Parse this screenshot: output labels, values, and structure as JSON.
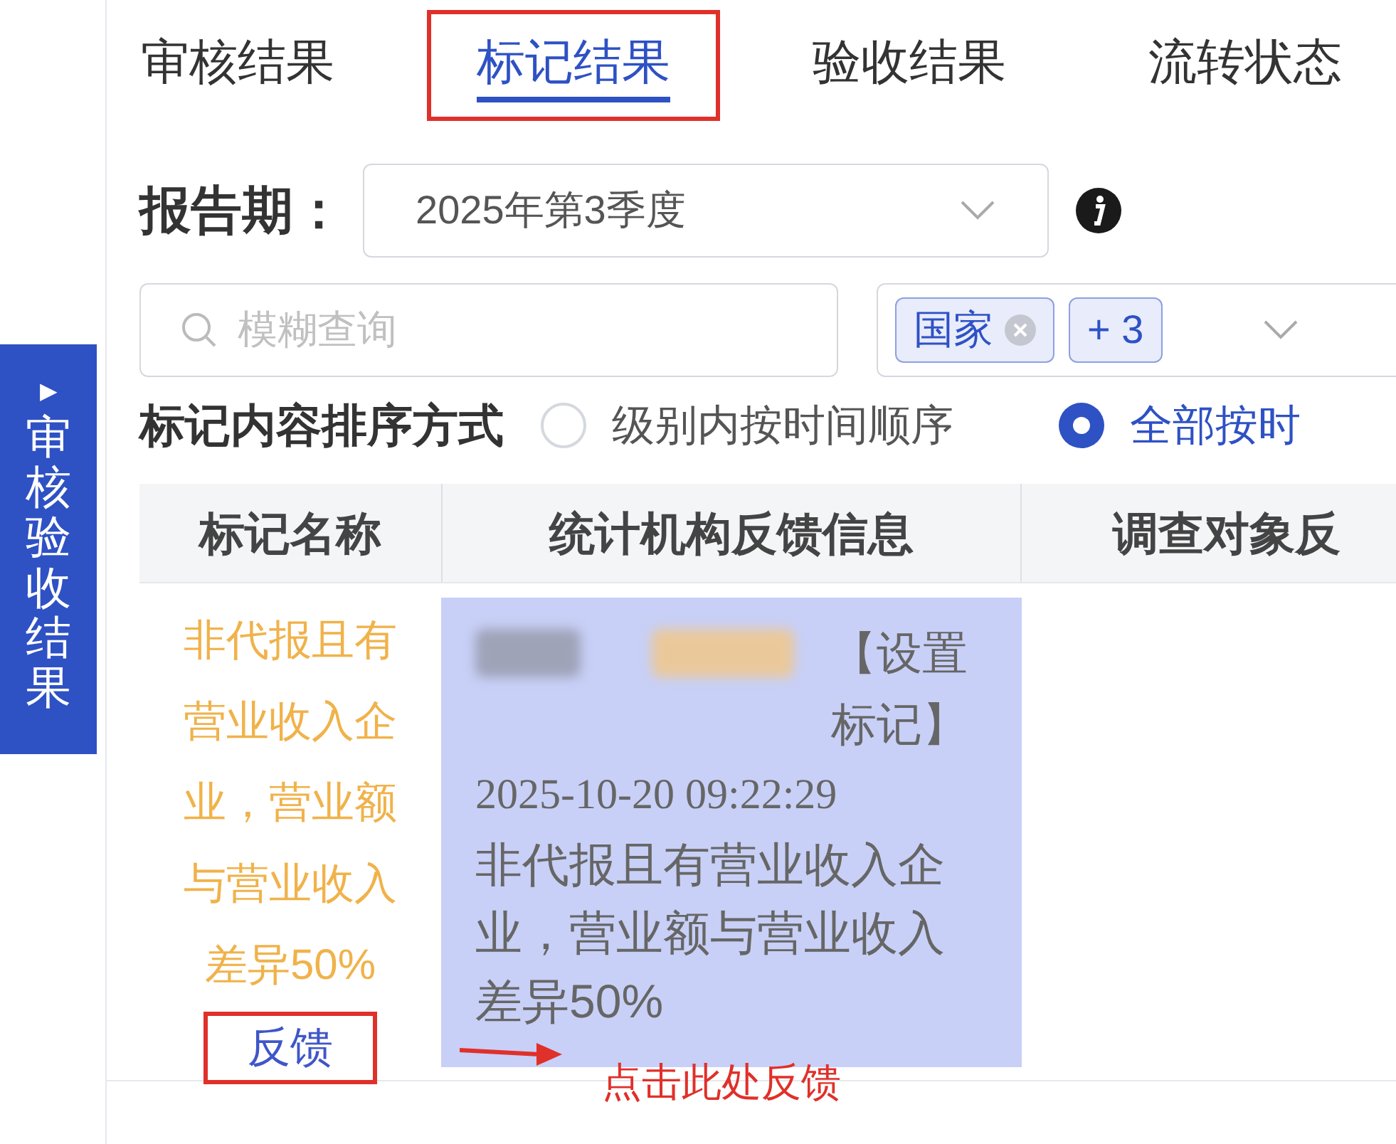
{
  "side_tab": {
    "arrow": "▶",
    "label": "审核验收结果"
  },
  "tabs": [
    {
      "label": "审核结果",
      "selected": false,
      "annotated": false
    },
    {
      "label": "标记结果",
      "selected": true,
      "annotated": true
    },
    {
      "label": "验收结果",
      "selected": false,
      "annotated": false
    },
    {
      "label": "流转状态",
      "selected": false,
      "annotated": false
    }
  ],
  "report_period": {
    "label": "报告期：",
    "value": "2025年第3季度"
  },
  "search": {
    "placeholder": "模糊查询"
  },
  "filter": {
    "tags": [
      "国家"
    ],
    "more": "+ 3"
  },
  "sort": {
    "label": "标记内容排序方式",
    "options": [
      {
        "label": "级别内按时间顺序",
        "selected": false
      },
      {
        "label": "全部按时",
        "selected": true
      }
    ]
  },
  "table": {
    "columns": [
      "标记名称",
      "统计机构反馈信息",
      "调查对象反"
    ],
    "rows": [
      {
        "mark_name": "非代报且有营业收入企业，营业额与营业收入差异50%",
        "action": "反馈",
        "action_annotated": true,
        "feedback": {
          "highlighted": true,
          "operation": "【设置标记】",
          "time": "2025-10-20 09:22:29",
          "message": "非代报且有营业收入企业，营业额与营业收入差异50%"
        }
      }
    ]
  },
  "callout": "点击此处反馈"
}
